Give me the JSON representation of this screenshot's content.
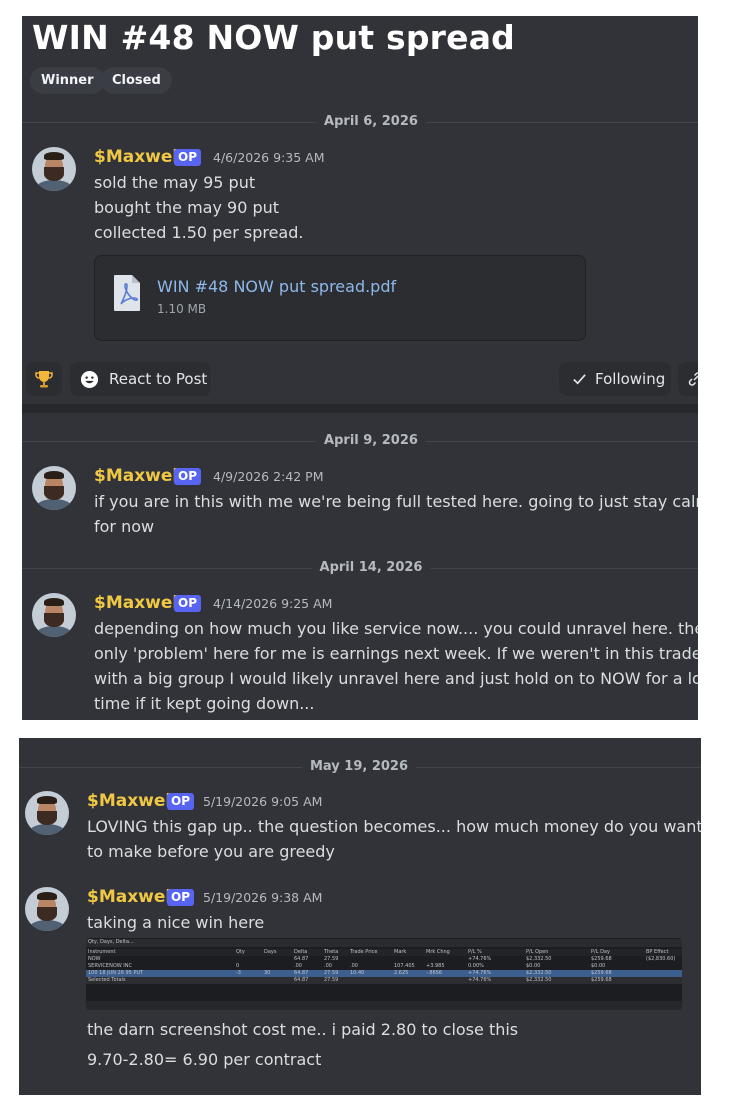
{
  "thread": {
    "title": "WIN #48 NOW put spread",
    "tags": [
      "Winner",
      "Closed"
    ]
  },
  "colors": {
    "background": "#313338",
    "username": "#f0c844",
    "op_badge": "#5865f2",
    "link": "#8fb8ea"
  },
  "post": {
    "date_divider": "April 6, 2026",
    "author": "$Maxwell",
    "op_badge": "OP",
    "timestamp": "4/6/2026 9:35 AM",
    "lines": [
      "sold the may 95 put",
      "bought the may 90 put",
      "collected 1.50 per spread."
    ],
    "attachment": {
      "icon": "pdf-file-icon",
      "name": "WIN #48 NOW put spread.pdf",
      "size": "1.10 MB"
    }
  },
  "actions": {
    "trophy_icon": "trophy-icon",
    "react_label": "React to Post",
    "following_label": "Following",
    "link_icon": "link-icon"
  },
  "messages": [
    {
      "date_divider": "April 9, 2026",
      "author": "$Maxwell",
      "op_badge": "OP",
      "timestamp": "4/9/2026 2:42 PM",
      "lines": [
        "if you are in this with me we're being full tested here. going to just stay calm",
        "for now"
      ]
    },
    {
      "date_divider": "April 14, 2026",
      "author": "$Maxwell",
      "op_badge": "OP",
      "timestamp": "4/14/2026 9:25 AM",
      "lines": [
        "depending on how much you like service now.... you could unravel here. the",
        "only 'problem' here for me is earnings next week. If we weren't in this trade",
        "with a big group I would likely unravel here and just hold on to NOW for a long",
        "time if it kept going down..."
      ]
    },
    {
      "date_divider": "May 19, 2026",
      "author": "$Maxwell",
      "op_badge": "OP",
      "timestamp": "5/19/2026 9:05 AM",
      "lines": [
        "LOVING this gap up.. the question becomes... how much money do you want",
        "to make before you are greedy"
      ]
    },
    {
      "author": "$Maxwell",
      "op_badge": "OP",
      "timestamp": "5/19/2026 9:38 AM",
      "lines": [
        "taking a nice win here"
      ],
      "after_lines": [
        "the darn screenshot cost me.. i paid 2.80 to close this",
        "9.70-2.80=  6.90 per contract"
      ]
    }
  ],
  "embedded_screenshot": {
    "toolbar": "Qty, Days, Delta...",
    "headers": [
      "Instrument",
      "Qty",
      "Days",
      "Delta",
      "Theta",
      "Trade Price",
      "Mark",
      "Mrk Chng",
      "P/L %",
      "P/L Open",
      "P/L Day",
      "BP Effect"
    ],
    "rows": [
      [
        "NOW",
        "",
        "",
        "64.87",
        "27.59",
        "",
        "",
        "",
        "+74.76%",
        "$2,332.50",
        "$259.68",
        "($2,830.60)"
      ],
      [
        "SERVICENOW INC",
        "0",
        "",
        ".00",
        ".00",
        ".00",
        "107.405",
        "+3.985",
        "0.00%",
        "$0.00",
        "$0.00",
        ""
      ],
      [
        "100 18 JUN 26 95 PUT",
        "-3",
        "30",
        "64.87",
        "27.59",
        "10.40",
        "2.625",
        "-.8656",
        "+74.76%",
        "$2,332.50",
        "$259.68",
        ""
      ],
      [
        "Selected Totals",
        "",
        "",
        "64.87",
        "27.59",
        "",
        "",
        "",
        "+74.76%",
        "$2,332.50",
        "$259.68",
        ""
      ]
    ]
  }
}
